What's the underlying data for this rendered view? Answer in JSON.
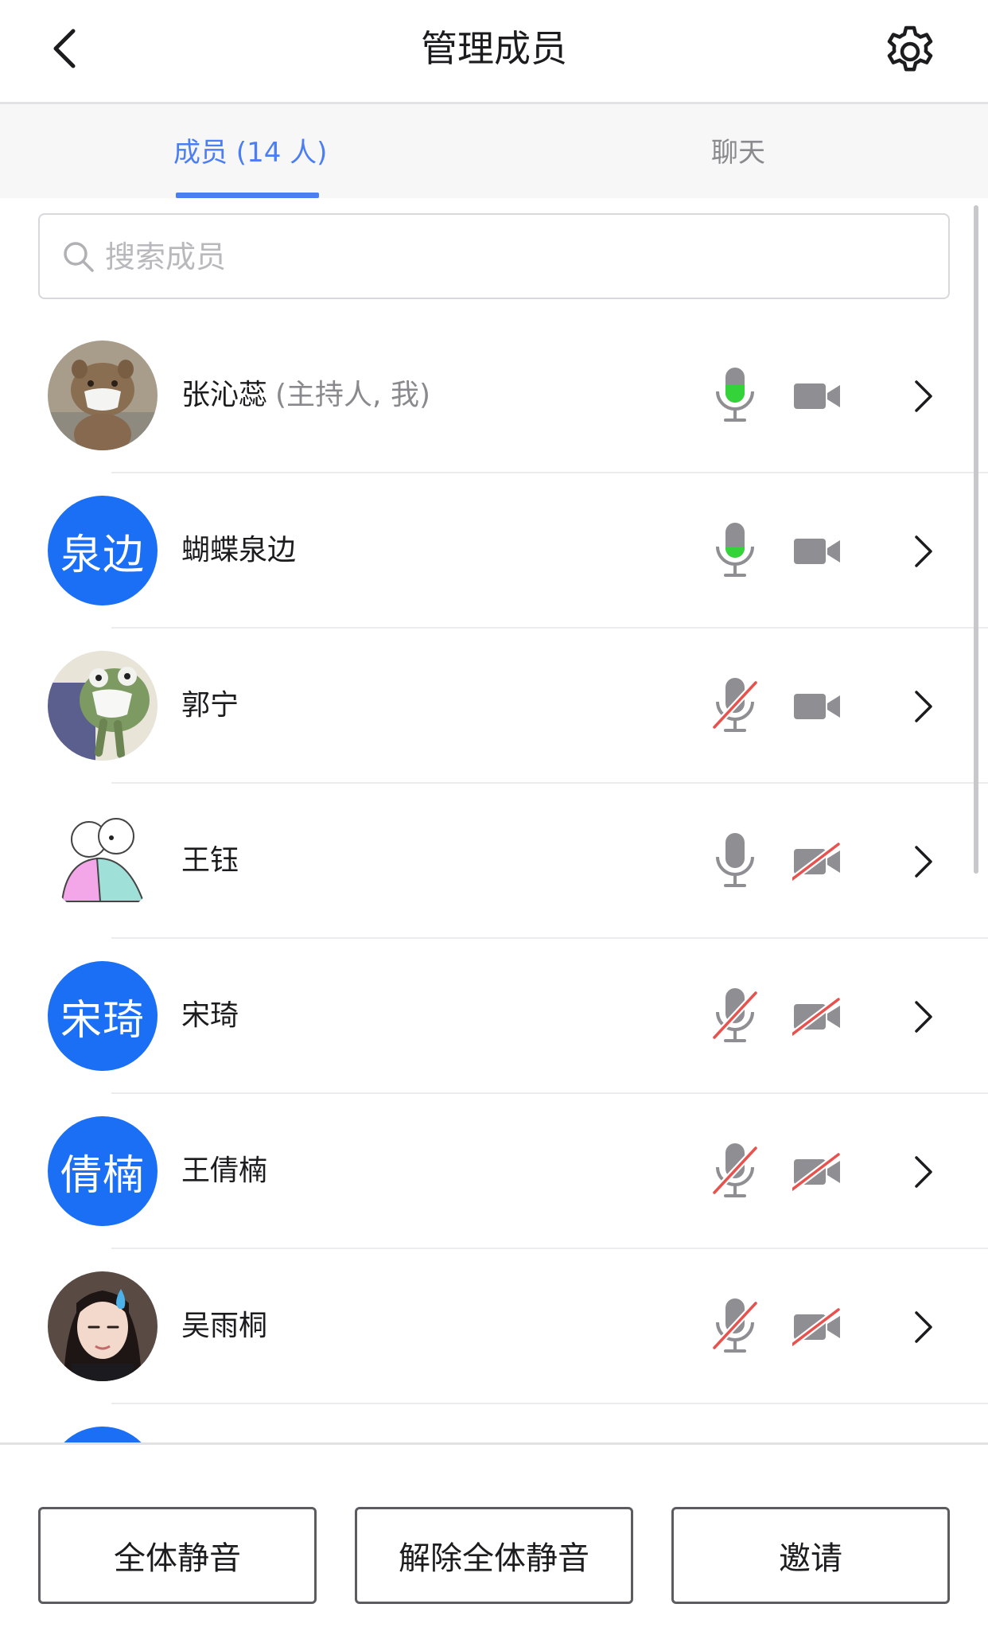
{
  "header": {
    "title": "管理成员",
    "back_icon": "chevron-left-icon",
    "settings_icon": "gear-icon"
  },
  "tabs": [
    {
      "label": "成员 (14 人)",
      "active": true
    },
    {
      "label": "聊天",
      "active": false
    }
  ],
  "search": {
    "placeholder": "搜索成员",
    "value": ""
  },
  "colors": {
    "accent": "#4c7ef3",
    "avatar_blue": "#1a6ff5",
    "mic_active": "#35d33a",
    "muted_slash": "#e8524e",
    "icon_gray": "#8e8e93"
  },
  "members": [
    {
      "name": "张沁蕊",
      "role": "(主持人, 我)",
      "avatar_text": "",
      "avatar_image": "quokka-with-mask",
      "mic": "speaking",
      "camera": "on"
    },
    {
      "name": "蝴蝶泉边",
      "role": "",
      "avatar_text": "泉边",
      "avatar_image": "",
      "mic": "speaking-low",
      "camera": "on"
    },
    {
      "name": "郭宁",
      "role": "",
      "avatar_text": "",
      "avatar_image": "frog-with-mask",
      "mic": "muted",
      "camera": "on"
    },
    {
      "name": "王钰",
      "role": "",
      "avatar_text": "",
      "avatar_image": "cartoon-hug",
      "mic": "on",
      "camera": "off"
    },
    {
      "name": "宋琦",
      "role": "",
      "avatar_text": "宋琦",
      "avatar_image": "",
      "mic": "muted",
      "camera": "off"
    },
    {
      "name": "王倩楠",
      "role": "",
      "avatar_text": "倩楠",
      "avatar_image": "",
      "mic": "muted",
      "camera": "off"
    },
    {
      "name": "吴雨桐",
      "role": "",
      "avatar_text": "",
      "avatar_image": "person-photo",
      "mic": "muted",
      "camera": "off"
    }
  ],
  "footer": {
    "mute_all": "全体静音",
    "unmute_all": "解除全体静音",
    "invite": "邀请"
  }
}
